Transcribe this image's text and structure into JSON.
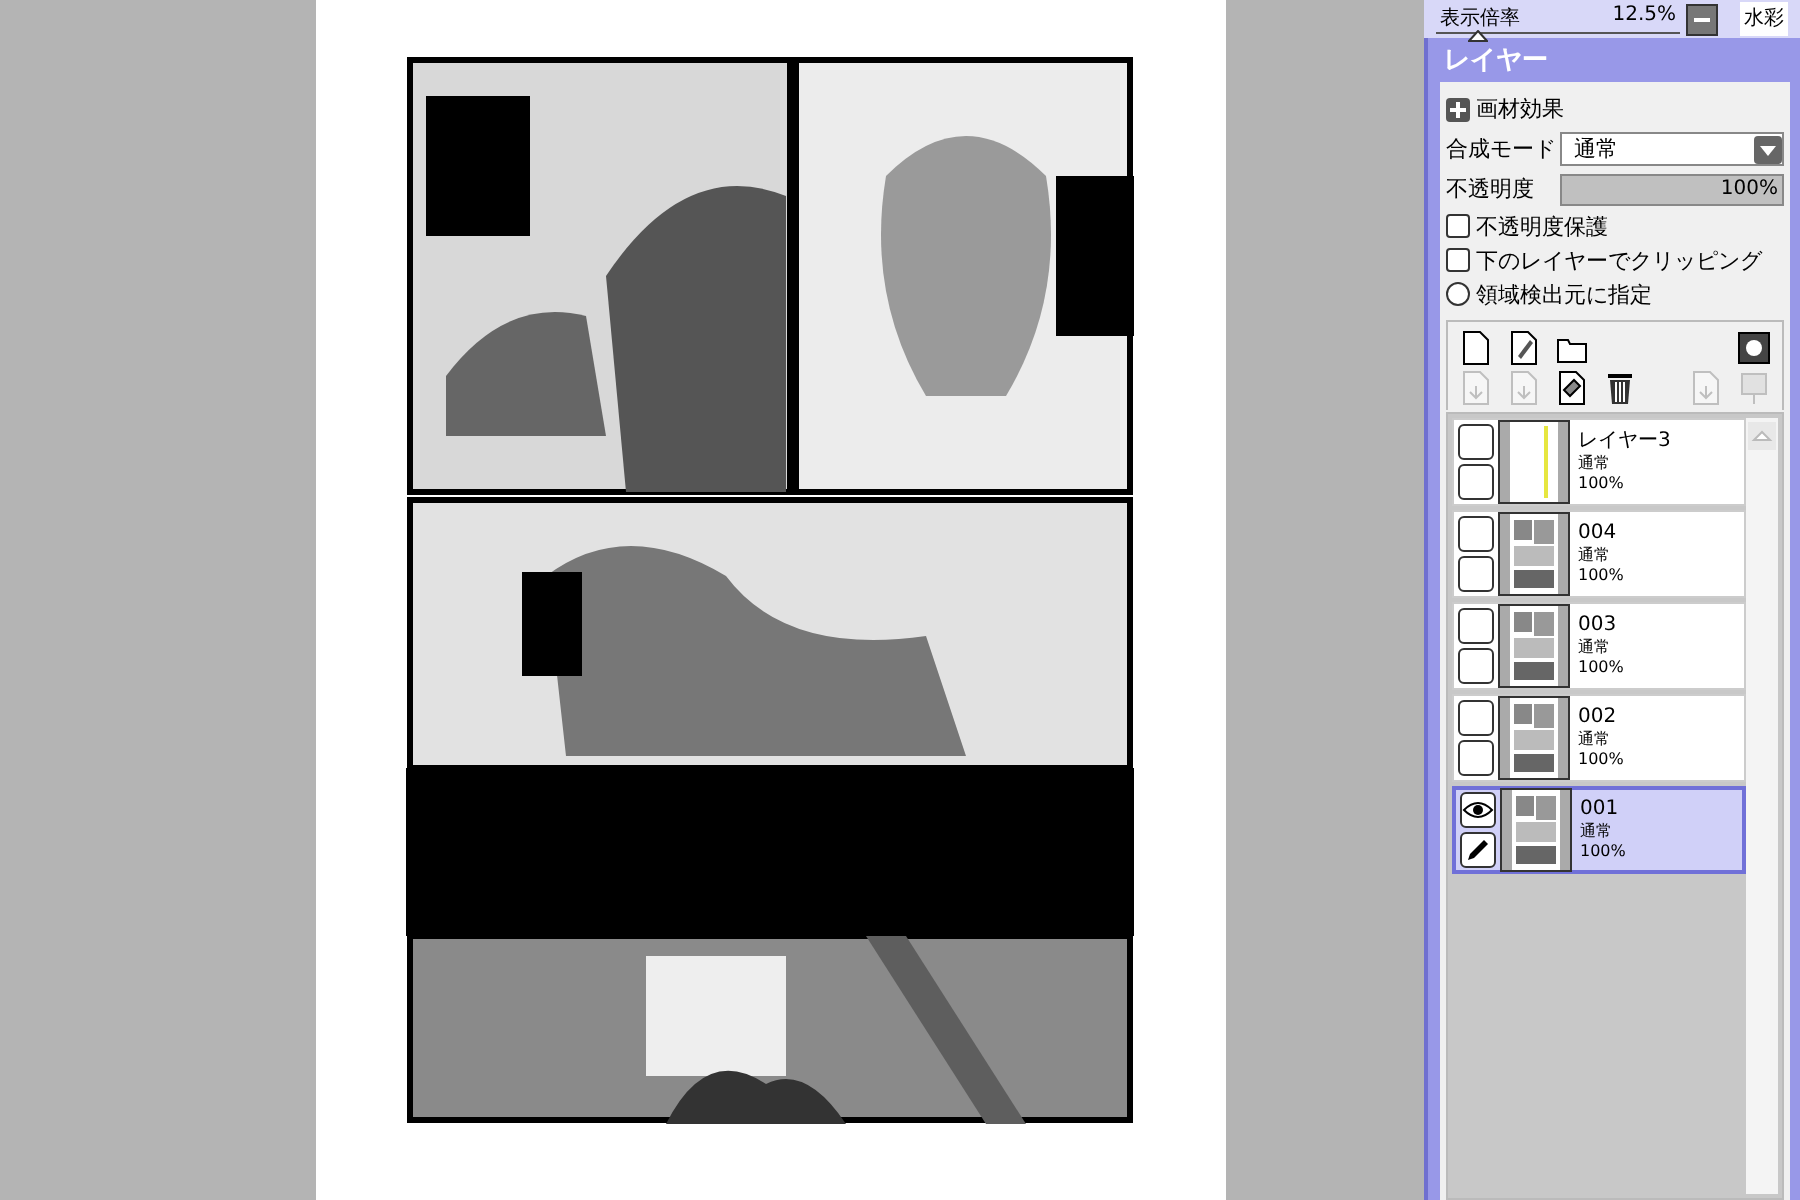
{
  "zoom_strip": {
    "label": "表示倍率",
    "value": "12.5%",
    "level": 0.17,
    "side_label": "水彩"
  },
  "layer_panel": {
    "title": "レイヤー",
    "effects_label": "画材効果",
    "blend_label": "合成モード",
    "blend_value": "通常",
    "opacity": {
      "label": "不透明度",
      "value": "100%",
      "level": 1
    },
    "options": [
      {
        "kind": "checkbox",
        "label": "不透明度保護",
        "checked": false
      },
      {
        "kind": "checkbox",
        "label": "下のレイヤーでクリッピング",
        "checked": false
      },
      {
        "kind": "radio",
        "label": "領域検出元に指定",
        "checked": false
      }
    ],
    "layers": [
      {
        "name": "レイヤー3",
        "mode": "通常",
        "opacity": "100%",
        "visible": false,
        "selected": false,
        "kind": "strip"
      },
      {
        "name": "004",
        "mode": "通常",
        "opacity": "100%",
        "visible": false,
        "selected": false,
        "kind": "page"
      },
      {
        "name": "003",
        "mode": "通常",
        "opacity": "100%",
        "visible": false,
        "selected": false,
        "kind": "page"
      },
      {
        "name": "002",
        "mode": "通常",
        "opacity": "100%",
        "visible": false,
        "selected": false,
        "kind": "page"
      },
      {
        "name": "001",
        "mode": "通常",
        "opacity": "100%",
        "visible": true,
        "selected": true,
        "kind": "page"
      }
    ]
  }
}
